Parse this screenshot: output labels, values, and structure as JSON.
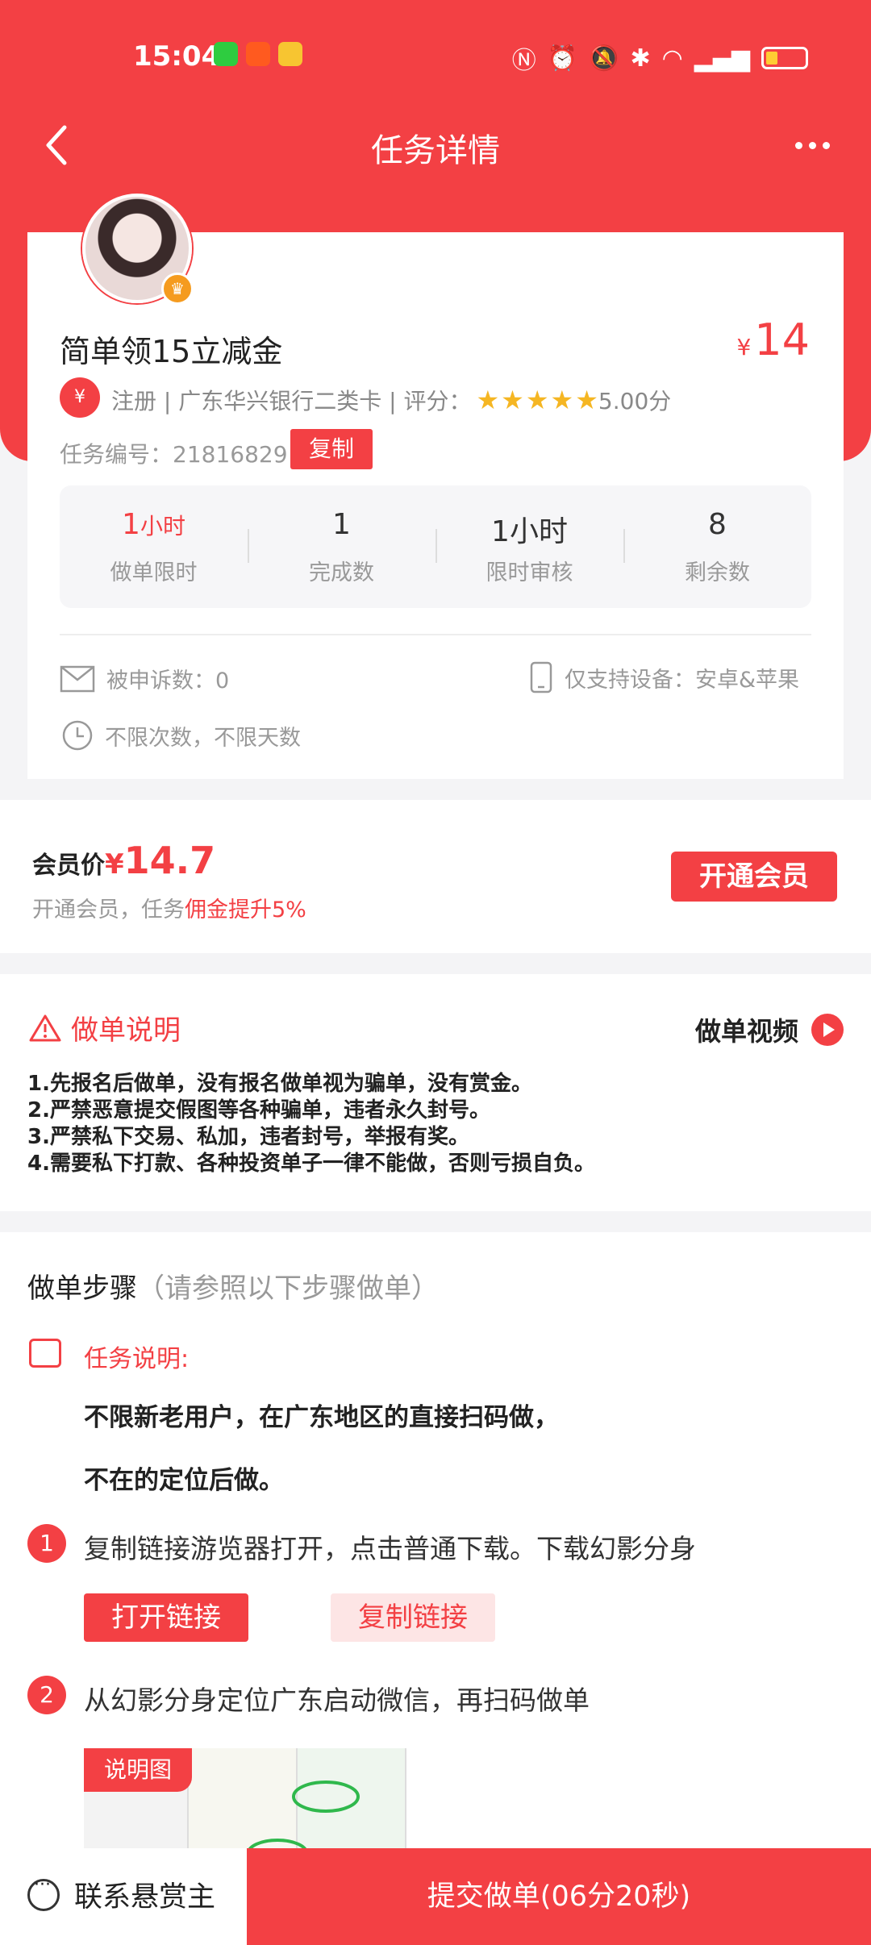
{
  "status_bar": {
    "time": "15:04"
  },
  "nav": {
    "title": "任务详情"
  },
  "task": {
    "title": "简单领15立减金",
    "price_symbol": "¥",
    "price": "14",
    "meta": "注册 | 广东华兴银行二类卡 | 评分：",
    "rating": "5.00分",
    "rating_stars": 5,
    "task_no": "任务编号：21816829",
    "copy_label": "复制",
    "stats": [
      {
        "value": "1",
        "unit": "小时",
        "label": "做单限时"
      },
      {
        "value": "1",
        "unit": "",
        "label": "完成数"
      },
      {
        "value": "1小时",
        "unit": "",
        "label": "限时审核"
      },
      {
        "value": "8",
        "unit": "",
        "label": "剩余数"
      }
    ],
    "complaints": "被申诉数：0",
    "devices": "仅支持设备：安卓&苹果",
    "limits": "不限次数，不限天数"
  },
  "member": {
    "label": "会员价",
    "price_symbol": "¥",
    "price": "14.7",
    "sub_prefix": "开通会员，任务",
    "sub_highlight": "佣金提升5%",
    "button": "开通会员"
  },
  "explain": {
    "title": "做单说明",
    "video": "做单视频",
    "rules": [
      "1.先报名后做单，没有报名做单视为骗单，没有赏金。",
      "2.严禁恶意提交假图等各种骗单，违者永久封号。",
      "3.严禁私下交易、私加，违者封号，举报有奖。",
      "4.需要私下打款、各种投资单子一律不能做，否则亏损自负。"
    ]
  },
  "steps": {
    "head": "做单步骤",
    "head_hint": "（请参照以下步骤做单）",
    "desc_label": "任务说明:",
    "desc_lines": [
      "不限新老用户，在广东地区的直接扫码做，",
      "不在的定位后做。"
    ],
    "step1_num": "1",
    "step1": "复制链接游览器打开，点击普通下载。下载幻影分身",
    "open_link": "打开链接",
    "copy_link": "复制链接",
    "step2_num": "2",
    "step2": "从幻影分身定位广东启动微信，再扫码做单",
    "thumb_tag": "说明图"
  },
  "bottom": {
    "contact": "联系悬赏主",
    "submit": "提交做单(06分20秒)"
  },
  "colors": {
    "accent": "#f34044",
    "star": "#f5b623"
  }
}
